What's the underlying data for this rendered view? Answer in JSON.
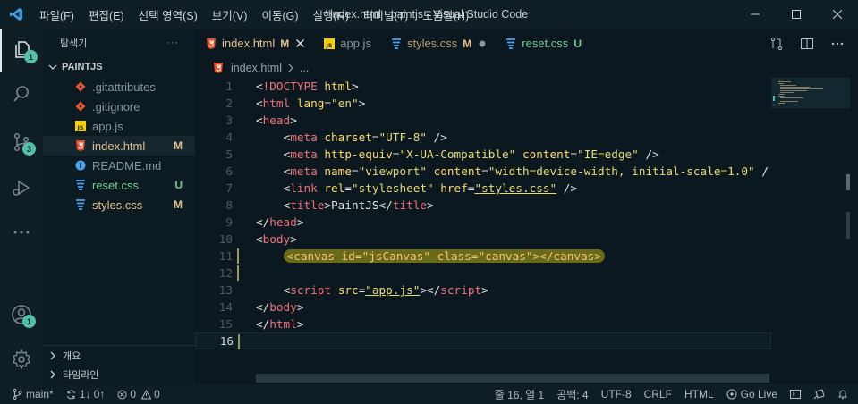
{
  "window": {
    "title": "index.html - paintjs - Visual Studio Code",
    "menu": [
      "파일(F)",
      "편집(E)",
      "선택 영역(S)",
      "보기(V)",
      "이동(G)",
      "실행(R)",
      "터미널(T)",
      "도움말(H)"
    ]
  },
  "activity_bar": {
    "explorer_badge": "1",
    "scm_badge": "3",
    "account_badge": "1"
  },
  "sidebar": {
    "title": "탐색기",
    "more": "···",
    "folder": "PAINTJS",
    "files": [
      {
        "name": ".gitattributes",
        "status": "",
        "icon": "git-icon"
      },
      {
        "name": ".gitignore",
        "status": "",
        "icon": "git-icon"
      },
      {
        "name": "app.js",
        "status": "",
        "icon": "js-icon"
      },
      {
        "name": "index.html",
        "status": "M",
        "icon": "html-icon"
      },
      {
        "name": "README.md",
        "status": "",
        "icon": "info-icon"
      },
      {
        "name": "reset.css",
        "status": "U",
        "icon": "css-icon"
      },
      {
        "name": "styles.css",
        "status": "M",
        "icon": "css-icon"
      }
    ],
    "outline": "개요",
    "timeline": "타임라인"
  },
  "tabs": [
    {
      "name": "index.html",
      "status": "M",
      "icon": "html-icon",
      "active": true
    },
    {
      "name": "app.js",
      "status": "",
      "icon": "js-icon",
      "active": false
    },
    {
      "name": "styles.css",
      "status": "M",
      "icon": "css-icon",
      "active": false
    },
    {
      "name": "reset.css",
      "status": "U",
      "icon": "css-icon",
      "active": false
    }
  ],
  "breadcrumb": {
    "file": "index.html",
    "rest": "..."
  },
  "editor": {
    "current_line": 16,
    "lines": [
      [
        [
          "punc",
          "<"
        ],
        [
          "tag",
          "!DOCTYPE"
        ],
        [
          "text",
          " "
        ],
        [
          "attr",
          "html"
        ],
        [
          "punc",
          ">"
        ]
      ],
      [
        [
          "punc",
          "<"
        ],
        [
          "tag",
          "html"
        ],
        [
          "text",
          " "
        ],
        [
          "attr",
          "lang"
        ],
        [
          "punc",
          "="
        ],
        [
          "str",
          "\"en\""
        ],
        [
          "punc",
          ">"
        ]
      ],
      [
        [
          "punc",
          "<"
        ],
        [
          "tag",
          "head"
        ],
        [
          "punc",
          ">"
        ]
      ],
      [
        [
          "text",
          "    "
        ],
        [
          "punc",
          "<"
        ],
        [
          "tag",
          "meta"
        ],
        [
          "text",
          " "
        ],
        [
          "attr",
          "charset"
        ],
        [
          "punc",
          "="
        ],
        [
          "str",
          "\"UTF-8\""
        ],
        [
          "text",
          " "
        ],
        [
          "punc",
          "/>"
        ]
      ],
      [
        [
          "text",
          "    "
        ],
        [
          "punc",
          "<"
        ],
        [
          "tag",
          "meta"
        ],
        [
          "text",
          " "
        ],
        [
          "attr",
          "http-equiv"
        ],
        [
          "punc",
          "="
        ],
        [
          "str",
          "\"X-UA-Compatible\""
        ],
        [
          "text",
          " "
        ],
        [
          "attr",
          "content"
        ],
        [
          "punc",
          "="
        ],
        [
          "str",
          "\"IE=edge\""
        ],
        [
          "text",
          " "
        ],
        [
          "punc",
          "/>"
        ]
      ],
      [
        [
          "text",
          "    "
        ],
        [
          "punc",
          "<"
        ],
        [
          "tag",
          "meta"
        ],
        [
          "text",
          " "
        ],
        [
          "attr",
          "name"
        ],
        [
          "punc",
          "="
        ],
        [
          "str",
          "\"viewport\""
        ],
        [
          "text",
          " "
        ],
        [
          "attr",
          "content"
        ],
        [
          "punc",
          "="
        ],
        [
          "str",
          "\"width=device-width, initial-scale=1.0\""
        ],
        [
          "text",
          " "
        ],
        [
          "punc",
          "/"
        ]
      ],
      [
        [
          "text",
          "    "
        ],
        [
          "punc",
          "<"
        ],
        [
          "tag",
          "link"
        ],
        [
          "text",
          " "
        ],
        [
          "attr",
          "rel"
        ],
        [
          "punc",
          "="
        ],
        [
          "str",
          "\"stylesheet\""
        ],
        [
          "text",
          " "
        ],
        [
          "attr",
          "href"
        ],
        [
          "punc",
          "="
        ],
        [
          "str",
          "\"styles.css\""
        ],
        [
          "text",
          " "
        ],
        [
          "punc",
          "/>"
        ]
      ],
      [
        [
          "text",
          "    "
        ],
        [
          "punc",
          "<"
        ],
        [
          "tag",
          "title"
        ],
        [
          "punc",
          ">"
        ],
        [
          "text",
          "PaintJS"
        ],
        [
          "punc",
          "</"
        ],
        [
          "tag",
          "title"
        ],
        [
          "punc",
          ">"
        ]
      ],
      [
        [
          "punc",
          "</"
        ],
        [
          "tag",
          "head"
        ],
        [
          "punc",
          ">"
        ]
      ],
      [
        [
          "punc",
          "<"
        ],
        [
          "tag",
          "body"
        ],
        [
          "punc",
          ">"
        ]
      ],
      [
        [
          "text",
          "    "
        ],
        [
          "hl",
          "<canvas id=\"jsCanvas\" class=\"canvas\"></canvas>"
        ]
      ],
      [],
      [
        [
          "text",
          "    "
        ],
        [
          "punc",
          "<"
        ],
        [
          "tag",
          "script"
        ],
        [
          "text",
          " "
        ],
        [
          "attr",
          "src"
        ],
        [
          "punc",
          "="
        ],
        [
          "str",
          "\"app.js\""
        ],
        [
          "punc",
          ">"
        ],
        [
          "punc",
          "</"
        ],
        [
          "tag",
          "script"
        ],
        [
          "punc",
          ">"
        ]
      ],
      [
        [
          "punc",
          "</"
        ],
        [
          "tag",
          "body"
        ],
        [
          "punc",
          ">"
        ]
      ],
      [
        [
          "punc",
          "</"
        ],
        [
          "tag",
          "html"
        ],
        [
          "punc",
          ">"
        ]
      ],
      []
    ]
  },
  "statusbar": {
    "branch": "main*",
    "sync": "1↓ 0↑",
    "problems": "0",
    "warnings": "0",
    "position": "줄 16, 열 1",
    "spaces": "공백: 4",
    "encoding": "UTF-8",
    "eol": "CRLF",
    "language": "HTML",
    "golive": "Go Live"
  },
  "colors": {
    "accent_badge": "#4fc1a6",
    "git_modified": "#e2c08d",
    "git_untracked": "#73c991",
    "highlight": "#6b6a18"
  }
}
